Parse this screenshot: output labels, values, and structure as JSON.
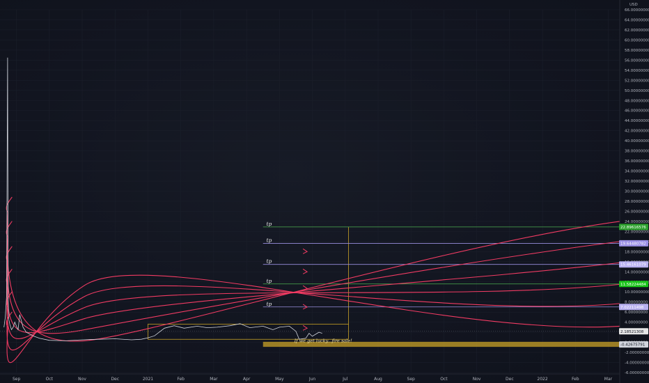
{
  "chart_data": {
    "type": "line",
    "currency_label": "USD",
    "y_ticks": [
      "66.00000000",
      "64.00000000",
      "62.00000000",
      "60.00000000",
      "58.00000000",
      "56.00000000",
      "54.00000000",
      "52.00000000",
      "50.00000000",
      "48.00000000",
      "46.00000000",
      "44.00000000",
      "42.00000000",
      "40.00000000",
      "38.00000000",
      "36.00000000",
      "34.00000000",
      "32.00000000",
      "30.00000000",
      "28.00000000",
      "26.00000000",
      "24.00000000",
      "22.00000000",
      "20.00000000",
      "18.00000000",
      "16.00000000",
      "14.00000000",
      "12.00000000",
      "10.00000000",
      "8.00000000",
      "6.00000000",
      "4.00000000",
      "2.00000000",
      "0.00000000",
      "-2.00000000",
      "-4.00000000",
      "-6.00000000"
    ],
    "ylim": [
      -6,
      66
    ],
    "x_ticks": [
      "Sep",
      "Oct",
      "Nov",
      "Dec",
      "2021",
      "Feb",
      "Mar",
      "Apr",
      "May",
      "Jun",
      "Jul",
      "Aug",
      "Sep",
      "Oct",
      "Nov",
      "Dec",
      "2022",
      "Feb",
      "Mar"
    ],
    "x_tick_positions": [
      8.5,
      9.5,
      10.5,
      11.5,
      12.5,
      13.5,
      14.5,
      15.5,
      16.5,
      17.5,
      18.5,
      19.5,
      20.5,
      21.5,
      22.5,
      23.5,
      24.5,
      25.5,
      26.5
    ],
    "xlim": [
      8.0,
      26.85
    ],
    "price_series": {
      "x": [
        8.12,
        8.16,
        8.2,
        8.23,
        8.25,
        8.27,
        8.3,
        8.35,
        8.4,
        8.45,
        8.5,
        8.55,
        8.6,
        8.7,
        8.8,
        9.0,
        9.2,
        9.5,
        10.0,
        10.5,
        11.0,
        11.5,
        12.0,
        12.3,
        12.5,
        12.7,
        13.0,
        13.3,
        13.6,
        14.0,
        14.3,
        14.6,
        15.0,
        15.3,
        15.6,
        16.0,
        16.3,
        16.5,
        16.8,
        17.0,
        17.1,
        17.3,
        17.4,
        17.5,
        17.7,
        17.8
      ],
      "y": [
        3.0,
        5.0,
        9.0,
        56.5,
        8.0,
        4.5,
        3.5,
        2.5,
        3.0,
        4.0,
        3.2,
        2.5,
        5.5,
        3.0,
        2.0,
        1.3,
        0.8,
        0.4,
        0.3,
        0.5,
        0.6,
        0.7,
        0.5,
        0.6,
        0.9,
        1.3,
        2.8,
        3.3,
        2.8,
        3.2,
        2.9,
        3.0,
        3.3,
        3.7,
        2.9,
        3.2,
        2.5,
        3.0,
        3.2,
        2.2,
        0.6,
        0.8,
        1.8,
        1.2,
        2.0,
        1.8
      ]
    },
    "parabolic_arcs": [
      {
        "from": [
          8.24,
          25.8
        ],
        "to": [
          26.85,
          24.0
        ],
        "arrow_at": [
          17.3,
          18.0
        ]
      },
      {
        "from": [
          8.24,
          21.0
        ],
        "to": [
          26.85,
          20.0
        ],
        "arrow_at": [
          17.3,
          14.0
        ]
      },
      {
        "from": [
          8.24,
          16.0
        ],
        "to": [
          26.85,
          15.8
        ],
        "arrow_at": [
          17.3,
          10.7
        ]
      },
      {
        "from": [
          8.24,
          11.5
        ],
        "to": [
          26.85,
          11.5
        ],
        "arrow_at": [
          17.3,
          7.0
        ]
      },
      {
        "from": [
          8.24,
          7.0
        ],
        "to": [
          26.85,
          7.7
        ],
        "arrow_at": [
          17.3,
          2.8
        ]
      },
      {
        "from": [
          8.24,
          3.0
        ],
        "to": [
          26.85,
          3.2
        ],
        "arrow_at": null
      }
    ],
    "arc_bottom_offset": [
      0.0,
      -4.0
    ],
    "tp_levels": [
      {
        "label": "tp",
        "value": 22.89616576,
        "color": "#4caf50",
        "badge_text": "22.89616576",
        "badge_bg": "#2ca02c",
        "badge_fg": "#ffffff"
      },
      {
        "label": "tp",
        "value": 19.64480782,
        "color": "#9a8fe0",
        "badge_text": "19.64480782",
        "badge_bg": "#9b8fe6",
        "badge_fg": "#ffffff"
      },
      {
        "label": "tp",
        "value": 15.46161079,
        "color": "#9a8fe0",
        "badge_text": "15.46161079",
        "badge_bg": "#b8b0f0",
        "badge_fg": "#ffffff"
      },
      {
        "label": "tp",
        "value": 11.58224484,
        "color": "#4caf50",
        "badge_text": "11.58224484",
        "badge_bg": "#19c419",
        "badge_fg": "#ffffff"
      },
      {
        "label": "tp",
        "value": 7.02211498,
        "color": "#9a8fe0",
        "badge_text": "7.02211498",
        "badge_bg": "#b8b0f0",
        "badge_fg": "#ffffff"
      }
    ],
    "tp_line_range": [
      16.0,
      26.85
    ],
    "current_price": {
      "value": 2.18521308,
      "badge_text": "2.18521308",
      "badge_bg": "#e6e6e6",
      "badge_fg": "#131722"
    },
    "support_level": {
      "value": -0.42675791,
      "badge_text": "-0.42675791",
      "badge_bg": "#d1d4dc",
      "badge_fg": "#131722",
      "band": [
        -0.9,
        0.1
      ],
      "band_range": [
        16.0,
        26.85
      ],
      "note": "If we get lucky...fire sale!"
    },
    "consolidation_box": {
      "x": [
        12.5,
        18.6
      ],
      "y": [
        0.6,
        3.6
      ],
      "color": "#c9a227"
    },
    "target_box": {
      "x": [
        18.6,
        18.6
      ],
      "y": [
        3.6,
        22.9
      ],
      "color": "#c9a227"
    },
    "colors": {
      "price": "#d1d4dc",
      "arc": "#f23b63",
      "grid": "#1b1f2b"
    }
  }
}
